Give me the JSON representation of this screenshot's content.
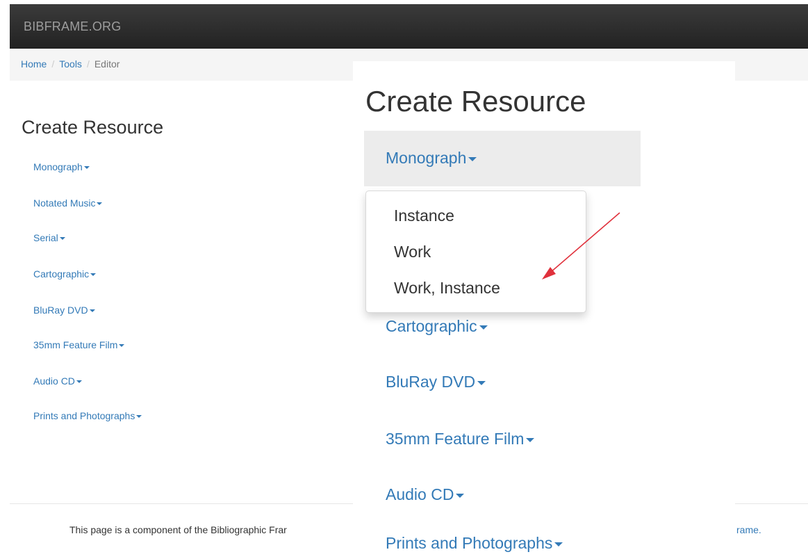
{
  "navbar": {
    "brand": "BIBFRAME.ORG"
  },
  "breadcrumb": {
    "items": [
      {
        "label": "Home",
        "link": true
      },
      {
        "label": "Tools",
        "link": true
      },
      {
        "label": "Editor",
        "link": false
      }
    ],
    "separator": "/"
  },
  "main": {
    "heading": "Create Resource",
    "resources": [
      "Monograph",
      "Notated Music",
      "Serial",
      "Cartographic",
      "BluRay DVD",
      "35mm Feature Film",
      "Audio CD",
      "Prints and Photographs"
    ]
  },
  "zoom": {
    "heading": "Create Resource",
    "active_item": "Monograph",
    "visible_items": [
      "Cartographic",
      "BluRay DVD",
      "35mm Feature Film",
      "Audio CD",
      "Prints and Photographs"
    ],
    "dropdown_options": [
      "Instance",
      "Work",
      "Work, Instance"
    ]
  },
  "footer": {
    "text_start": "This page is a component of the Bibliographic Frar",
    "text_end": "rame."
  },
  "colors": {
    "link": "#337ab7",
    "navbar": "#222222",
    "annotation_arrow": "#e0313c"
  },
  "annotation": {
    "icon": "red-arrow-icon",
    "points_to": "Work, Instance"
  }
}
